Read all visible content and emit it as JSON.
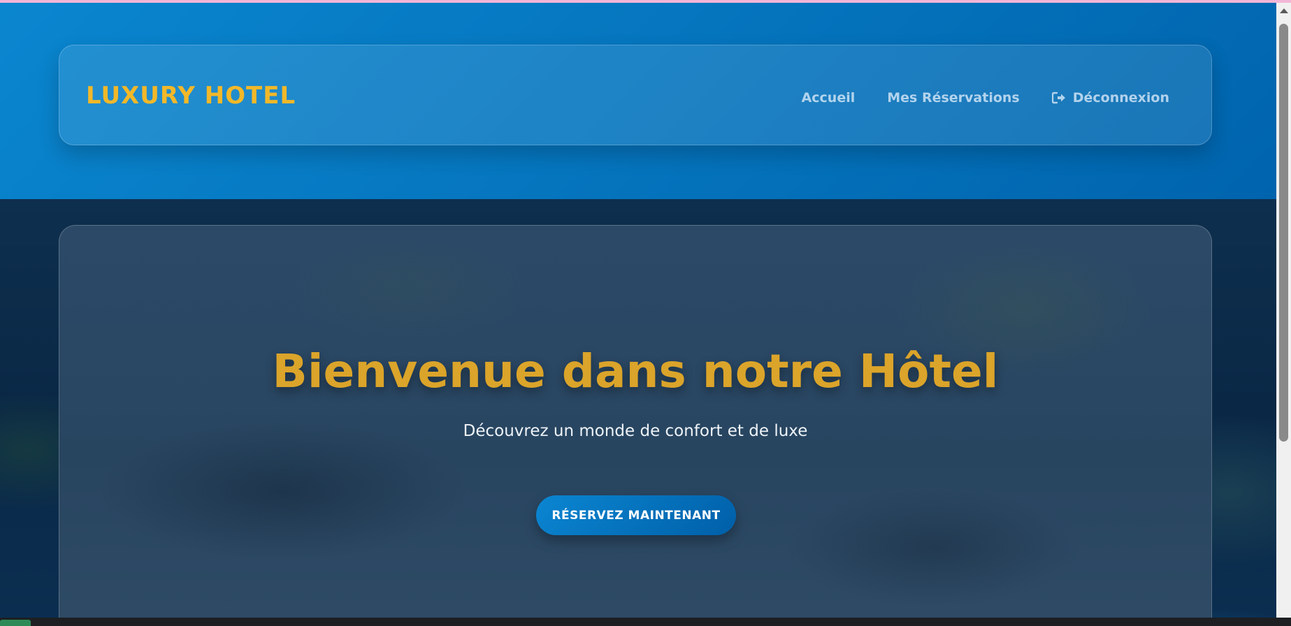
{
  "brand": {
    "name": "LUXURY HOTEL"
  },
  "nav": {
    "items": [
      {
        "label": "Accueil"
      },
      {
        "label": "Mes Réservations"
      },
      {
        "label": "Déconnexion",
        "icon": "logout-icon"
      }
    ]
  },
  "hero": {
    "title": "Bienvenue dans notre Hôtel",
    "subtitle": "Découvrez un monde de confort et de luxe",
    "cta_label": "RÉSERVEZ MAINTENANT"
  },
  "colors": {
    "brand_gold": "#f2b829",
    "header_blue": "#0a86cf",
    "cta_blue": "#0b86d2",
    "title_gold": "#dba42a"
  }
}
